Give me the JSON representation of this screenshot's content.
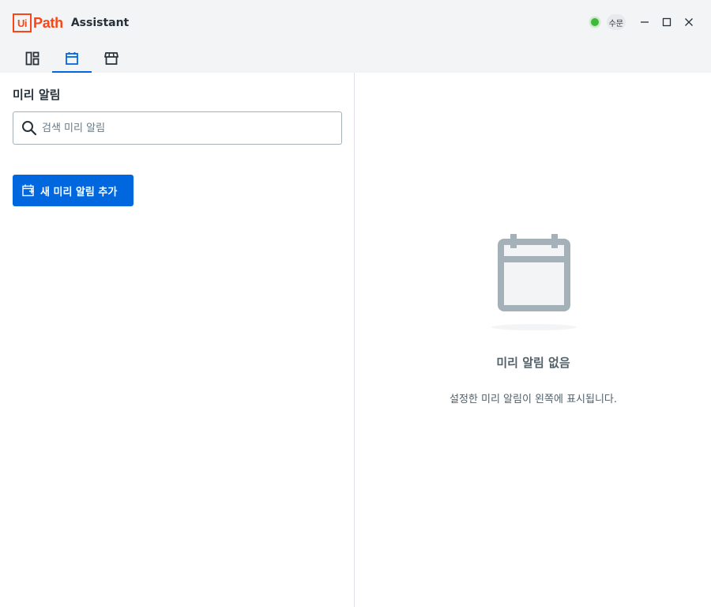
{
  "app": {
    "logo_ui": "Ui",
    "logo_path": "Path",
    "name": "Assistant"
  },
  "window": {
    "status": "connected",
    "status_color": "#3dba3a",
    "user_initials": "수문"
  },
  "tabs": [
    {
      "name": "home",
      "icon": "dashboard-icon",
      "active": false
    },
    {
      "name": "reminders",
      "icon": "calendar-icon",
      "active": true
    },
    {
      "name": "marketplace",
      "icon": "store-icon",
      "active": false
    }
  ],
  "reminders": {
    "title": "미리 알림",
    "search_placeholder": "검색 미리 알림",
    "add_button_label": "새 미리 알림 추가"
  },
  "empty_state": {
    "icon": "calendar-illustration",
    "title": "미리 알림 없음",
    "description": "설정한 미리 알림이 왼쪽에 표시됩니다."
  },
  "colors": {
    "accent": "#0067df",
    "brand": "#fa4616",
    "titlebar_bg": "#f3f4f6"
  }
}
